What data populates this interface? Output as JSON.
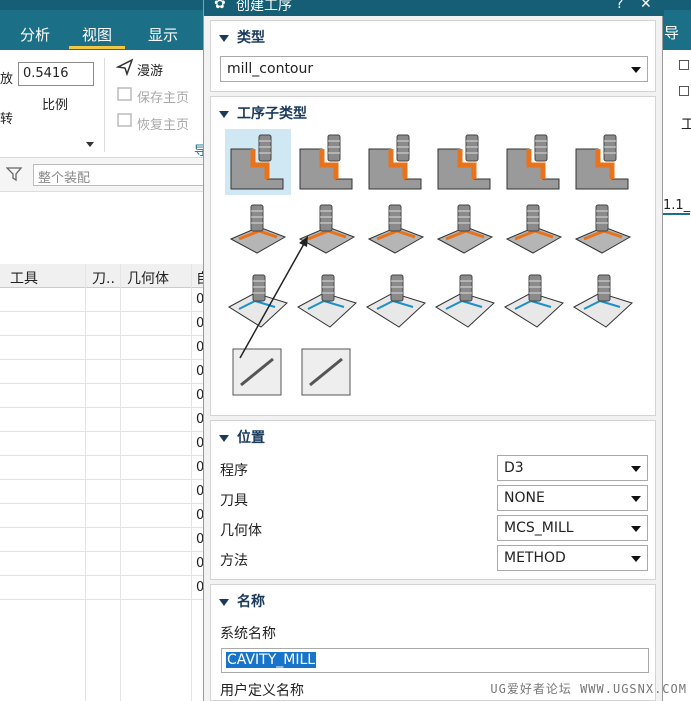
{
  "ribbon": {
    "tabs": [
      "分析",
      "视图",
      "显示"
    ],
    "active_tab": "视图",
    "scale_prefix": "放",
    "scale_value": "0.5416",
    "scale_label": "比例",
    "left_edge_label": "转",
    "roam_label": "漫游",
    "save_view_label": "保存主页",
    "restore_view_label": "恢复主页",
    "group_label_fragment": "导"
  },
  "filter": {
    "placeholder": "整个装配"
  },
  "table": {
    "headers": [
      "工具",
      "刀..",
      "几何体",
      "自"
    ],
    "rows": [
      "0",
      "0",
      "0",
      "0",
      "0",
      "0",
      "0",
      "0",
      "0",
      "0",
      "0",
      "0",
      "0"
    ]
  },
  "right_strip": {
    "fragment_label": "1.1_",
    "tail_label": "导",
    "side_label": "工"
  },
  "dialog": {
    "title": "创建工序",
    "help_icon": "?",
    "type_section": {
      "title": "类型",
      "value": "mill_contour"
    },
    "subtype_section": {
      "title": "工序子类型",
      "icons": [
        "cavity-mill-icon",
        "adaptive-milling-icon",
        "plunge-milling-icon",
        "corner-rough-icon",
        "rest-milling-icon",
        "zlevel-profile-icon",
        "zlevel-corner-icon",
        "fixed-contour-icon",
        "contour-area-icon",
        "contour-surface-area-icon",
        "streamline-icon",
        "contour-area-nonsteep-icon",
        "contour-area-dir-steep-icon",
        "flowcut-single-icon",
        "flowcut-multiple-icon",
        "flowcut-ref-tool-icon",
        "solid-profile-3d-icon",
        "contour-text-icon",
        "mill-control-icon",
        "mill-user-icon"
      ],
      "selected_index": 0
    },
    "location_section": {
      "title": "位置",
      "fields": [
        {
          "label": "程序",
          "value": "D3"
        },
        {
          "label": "刀具",
          "value": "NONE"
        },
        {
          "label": "几何体",
          "value": "MCS_MILL"
        },
        {
          "label": "方法",
          "value": "METHOD"
        }
      ]
    },
    "name_section": {
      "title": "名称",
      "system_name_label": "系统名称",
      "system_name_value": "CAVITY_MILL",
      "user_name_label": "用户定义名称"
    }
  },
  "watermark": "UG爱好者论坛 WWW.UGSNX.COM",
  "colors": {
    "title_bar": "#155e75",
    "accent_orange": "#e8731a",
    "selection": "#cfe8f3",
    "highlight": "#1874c9"
  }
}
